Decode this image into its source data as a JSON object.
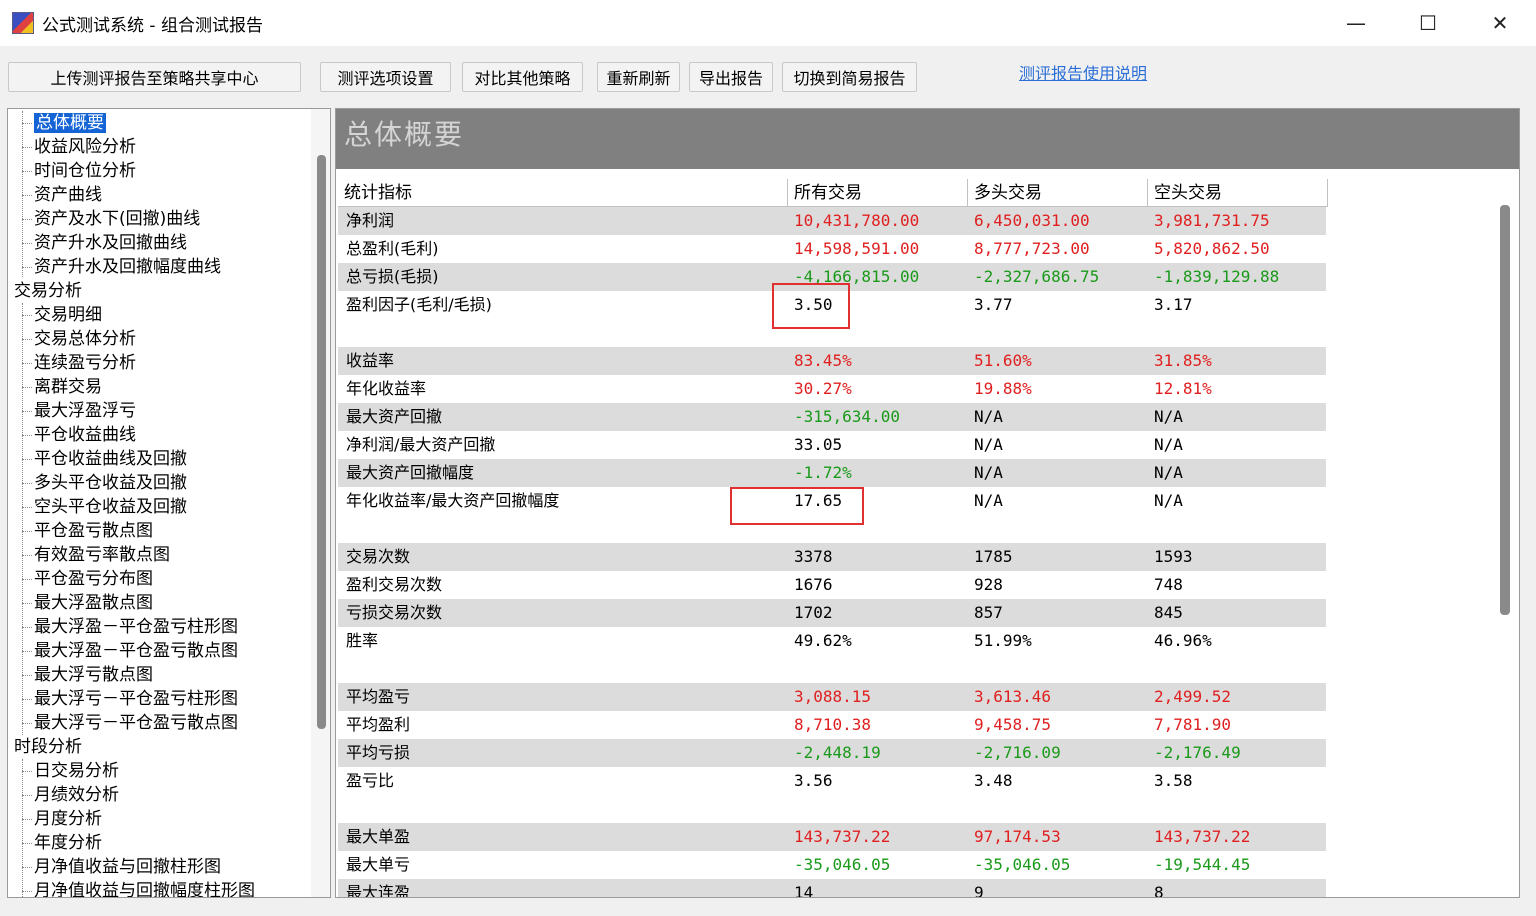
{
  "window": {
    "title": "公式测试系统 - 组合测试报告",
    "minimize": "—",
    "maximize": "☐",
    "close": "✕"
  },
  "toolbar": {
    "upload": "上传测评报告至策略共享中心",
    "options": "测评选项设置",
    "compare": "对比其他策略",
    "refresh": "重新刷新",
    "export": "导出报告",
    "simple": "切换到简易报告",
    "help_link": "测评报告使用说明"
  },
  "tree": {
    "items": [
      {
        "label": "总体概要",
        "level": 1,
        "selected": true
      },
      {
        "label": "收益风险分析",
        "level": 1
      },
      {
        "label": "时间仓位分析",
        "level": 1
      },
      {
        "label": "资产曲线",
        "level": 1
      },
      {
        "label": "资产及水下(回撤)曲线",
        "level": 1
      },
      {
        "label": "资产升水及回撤曲线",
        "level": 1
      },
      {
        "label": "资产升水及回撤幅度曲线",
        "level": 1
      },
      {
        "label": "交易分析",
        "level": 0
      },
      {
        "label": "交易明细",
        "level": 1
      },
      {
        "label": "交易总体分析",
        "level": 1
      },
      {
        "label": "连续盈亏分析",
        "level": 1
      },
      {
        "label": "离群交易",
        "level": 1
      },
      {
        "label": "最大浮盈浮亏",
        "level": 1
      },
      {
        "label": "平仓收益曲线",
        "level": 1
      },
      {
        "label": "平仓收益曲线及回撤",
        "level": 1
      },
      {
        "label": "多头平仓收益及回撤",
        "level": 1
      },
      {
        "label": "空头平仓收益及回撤",
        "level": 1
      },
      {
        "label": "平仓盈亏散点图",
        "level": 1
      },
      {
        "label": "有效盈亏率散点图",
        "level": 1
      },
      {
        "label": "平仓盈亏分布图",
        "level": 1
      },
      {
        "label": "最大浮盈散点图",
        "level": 1
      },
      {
        "label": "最大浮盈－平仓盈亏柱形图",
        "level": 1
      },
      {
        "label": "最大浮盈－平仓盈亏散点图",
        "level": 1
      },
      {
        "label": "最大浮亏散点图",
        "level": 1
      },
      {
        "label": "最大浮亏－平仓盈亏柱形图",
        "level": 1
      },
      {
        "label": "最大浮亏－平仓盈亏散点图",
        "level": 1
      },
      {
        "label": "时段分析",
        "level": 0
      },
      {
        "label": "日交易分析",
        "level": 1
      },
      {
        "label": "月绩效分析",
        "level": 1
      },
      {
        "label": "月度分析",
        "level": 1
      },
      {
        "label": "年度分析",
        "level": 1
      },
      {
        "label": "月净值收益与回撤柱形图",
        "level": 1
      },
      {
        "label": "月净值收益与回撤幅度柱形图",
        "level": 1
      }
    ]
  },
  "main": {
    "section_title": "总体概要",
    "headers": [
      "统计指标",
      "所有交易",
      "多头交易",
      "空头交易"
    ],
    "rows": [
      {
        "label": "净利润",
        "v": [
          "10,431,780.00",
          "6,450,031.00",
          "3,981,731.75"
        ],
        "c": [
          "red",
          "red",
          "red"
        ],
        "shade": true
      },
      {
        "label": "总盈利(毛利)",
        "v": [
          "14,598,591.00",
          "8,777,723.00",
          "5,820,862.50"
        ],
        "c": [
          "red",
          "red",
          "red"
        ],
        "shade": false
      },
      {
        "label": "总亏损(毛损)",
        "v": [
          "-4,166,815.00",
          "-2,327,686.75",
          "-1,839,129.88"
        ],
        "c": [
          "green",
          "green",
          "green"
        ],
        "shade": true
      },
      {
        "label": "盈利因子(毛利/毛损)",
        "v": [
          "3.50",
          "3.77",
          "3.17"
        ],
        "c": [
          "black",
          "black",
          "black"
        ],
        "shade": false,
        "tall": true
      },
      {
        "label": "收益率",
        "v": [
          "83.45%",
          "51.60%",
          "31.85%"
        ],
        "c": [
          "red",
          "red",
          "red"
        ],
        "shade": true
      },
      {
        "label": "年化收益率",
        "v": [
          "30.27%",
          "19.88%",
          "12.81%"
        ],
        "c": [
          "red",
          "red",
          "red"
        ],
        "shade": false
      },
      {
        "label": "最大资产回撤",
        "v": [
          "-315,634.00",
          "N/A",
          "N/A"
        ],
        "c": [
          "green",
          "black",
          "black"
        ],
        "shade": true
      },
      {
        "label": "净利润/最大资产回撤",
        "v": [
          "33.05",
          "N/A",
          "N/A"
        ],
        "c": [
          "black",
          "black",
          "black"
        ],
        "shade": false
      },
      {
        "label": "最大资产回撤幅度",
        "v": [
          "-1.72%",
          "N/A",
          "N/A"
        ],
        "c": [
          "green",
          "black",
          "black"
        ],
        "shade": true
      },
      {
        "label": "年化收益率/最大资产回撤幅度",
        "v": [
          "17.65",
          "N/A",
          "N/A"
        ],
        "c": [
          "black",
          "black",
          "black"
        ],
        "shade": false,
        "tall": true
      },
      {
        "label": "交易次数",
        "v": [
          "3378",
          "1785",
          "1593"
        ],
        "c": [
          "black",
          "black",
          "black"
        ],
        "shade": true
      },
      {
        "label": "盈利交易次数",
        "v": [
          "1676",
          "928",
          "748"
        ],
        "c": [
          "black",
          "black",
          "black"
        ],
        "shade": false
      },
      {
        "label": "亏损交易次数",
        "v": [
          "1702",
          "857",
          "845"
        ],
        "c": [
          "black",
          "black",
          "black"
        ],
        "shade": true
      },
      {
        "label": "胜率",
        "v": [
          "49.62%",
          "51.99%",
          "46.96%"
        ],
        "c": [
          "black",
          "black",
          "black"
        ],
        "shade": false,
        "tall": true
      },
      {
        "label": "平均盈亏",
        "v": [
          "3,088.15",
          "3,613.46",
          "2,499.52"
        ],
        "c": [
          "red",
          "red",
          "red"
        ],
        "shade": true
      },
      {
        "label": "平均盈利",
        "v": [
          "8,710.38",
          "9,458.75",
          "7,781.90"
        ],
        "c": [
          "red",
          "red",
          "red"
        ],
        "shade": false
      },
      {
        "label": "平均亏损",
        "v": [
          "-2,448.19",
          "-2,716.09",
          "-2,176.49"
        ],
        "c": [
          "green",
          "green",
          "green"
        ],
        "shade": true
      },
      {
        "label": "盈亏比",
        "v": [
          "3.56",
          "3.48",
          "3.58"
        ],
        "c": [
          "black",
          "black",
          "black"
        ],
        "shade": false,
        "tall": true
      },
      {
        "label": "最大单盈",
        "v": [
          "143,737.22",
          "97,174.53",
          "143,737.22"
        ],
        "c": [
          "red",
          "red",
          "red"
        ],
        "shade": true
      },
      {
        "label": "最大单亏",
        "v": [
          "-35,046.05",
          "-35,046.05",
          "-19,544.45"
        ],
        "c": [
          "green",
          "green",
          "green"
        ],
        "shade": false
      },
      {
        "label": "最大连盈",
        "v": [
          "14",
          "9",
          "8"
        ],
        "c": [
          "black",
          "black",
          "black"
        ],
        "shade": true
      }
    ]
  }
}
